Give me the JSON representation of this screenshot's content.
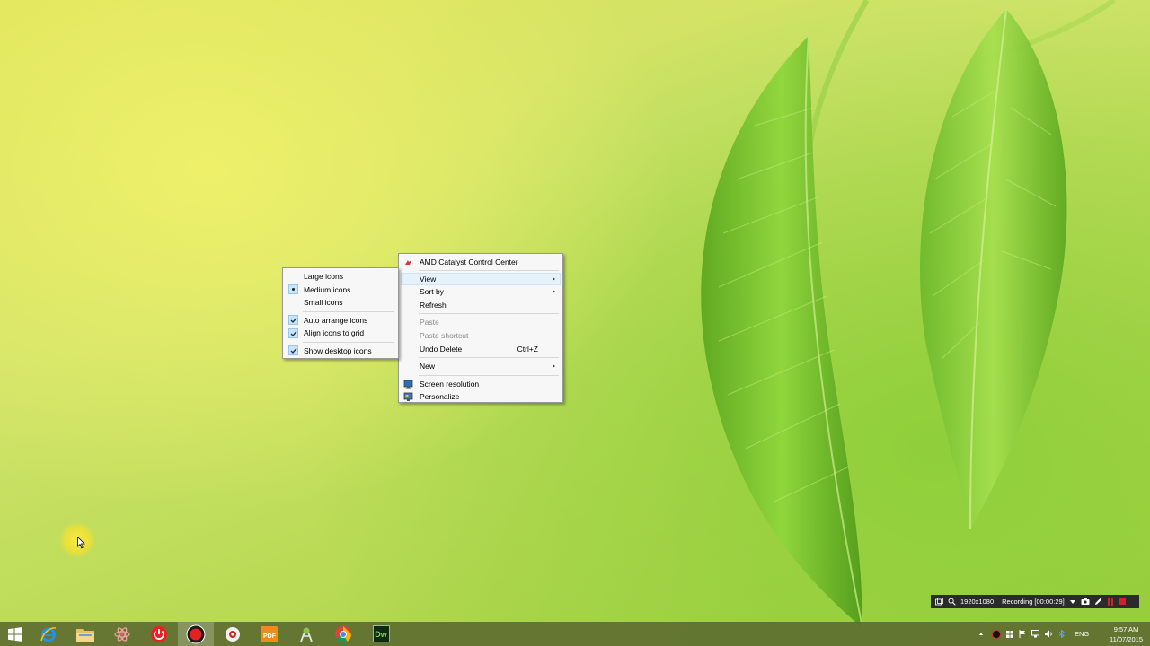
{
  "desktop": {
    "wallpaper": "green-leaf-wallpaper"
  },
  "context_menu": {
    "items": [
      {
        "label": "AMD Catalyst Control Center",
        "icon": "amd-icon"
      },
      {
        "label": "View",
        "submenu": true,
        "highlighted": true
      },
      {
        "label": "Sort by",
        "submenu": true
      },
      {
        "label": "Refresh"
      },
      {
        "label": "Paste",
        "disabled": true
      },
      {
        "label": "Paste shortcut",
        "disabled": true
      },
      {
        "label": "Undo Delete",
        "shortcut": "Ctrl+Z"
      },
      {
        "label": "New",
        "submenu": true
      },
      {
        "label": "Screen resolution",
        "icon": "monitor-icon"
      },
      {
        "label": "Personalize",
        "icon": "personalize-icon"
      }
    ]
  },
  "view_submenu": {
    "items": [
      {
        "label": "Large icons",
        "state": "none"
      },
      {
        "label": "Medium icons",
        "state": "radio"
      },
      {
        "label": "Small icons",
        "state": "none"
      },
      {
        "label": "Auto arrange icons",
        "state": "check"
      },
      {
        "label": "Align icons to grid",
        "state": "check"
      },
      {
        "label": "Show desktop icons",
        "state": "check"
      }
    ]
  },
  "recording_bar": {
    "resolution": "1920x1080",
    "status": "Recording [00:00:29]"
  },
  "taskbar": {
    "apps": [
      {
        "name": "start-button",
        "icon": "windows-logo-icon"
      },
      {
        "name": "internet-explorer",
        "icon": "internet-explorer-icon"
      },
      {
        "name": "file-explorer",
        "icon": "folder-icon"
      },
      {
        "name": "app-atom",
        "icon": "atom-icon"
      },
      {
        "name": "app-power",
        "icon": "power-icon"
      },
      {
        "name": "app-recorder",
        "icon": "record-icon",
        "active": true
      },
      {
        "name": "app-webcam",
        "icon": "webcam-icon"
      },
      {
        "name": "app-pdf",
        "icon": "pdf-icon"
      },
      {
        "name": "app-android",
        "icon": "android-icon"
      },
      {
        "name": "google-chrome",
        "icon": "chrome-icon"
      },
      {
        "name": "dreamweaver",
        "icon": "dreamweaver-icon",
        "label": "Dw"
      }
    ],
    "pdf_label": "PDF",
    "language": "ENG",
    "time": "9:57 AM",
    "date": "11/07/2015"
  },
  "colors": {
    "menu_highlight": "#e5f1fb",
    "taskbar": "#5e6e30",
    "accent_red": "#e32222"
  }
}
